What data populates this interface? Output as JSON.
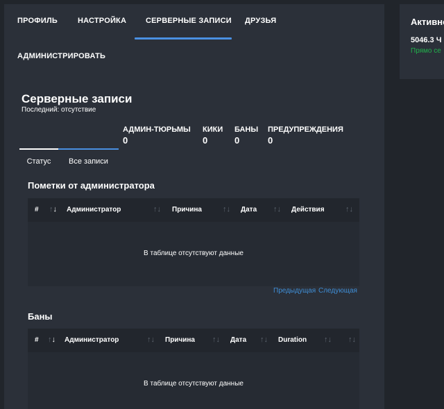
{
  "nav": {
    "tabs": [
      {
        "label": "ПРОФИЛЬ"
      },
      {
        "label": "НАСТРОЙКА"
      },
      {
        "label": "СЕРВЕРНЫЕ ЗАПИСИ"
      },
      {
        "label": "ДРУЗЬЯ"
      },
      {
        "label": "АДМИНИСТРИРОВАТЬ"
      }
    ],
    "active_tab": "СЕРВЕРНЫЕ ЗАПИСИ"
  },
  "records": {
    "title": "Серверные записи",
    "last_label": "Последний: отсутствие",
    "stats": [
      {
        "label": "АДМИН-ТЮРЬМЫ",
        "value": "0"
      },
      {
        "label": "КИКИ",
        "value": "0"
      },
      {
        "label": "БАНЫ",
        "value": "0"
      },
      {
        "label": "ПРЕДУПРЕЖДЕНИЯ",
        "value": "0"
      }
    ],
    "tabs": [
      {
        "label": "Статус"
      },
      {
        "label": "Все записи"
      }
    ]
  },
  "notes": {
    "title": "Пометки от администратора",
    "columns": [
      "#",
      "Администратор",
      "Причина",
      "Дата",
      "Действия"
    ],
    "empty_text": "В таблице отсутствуют данные",
    "prev_label": "Предыдущая",
    "next_label": "Следующая"
  },
  "bans": {
    "title": "Баны",
    "columns": [
      "#",
      "Администратор",
      "Причина",
      "Дата",
      "Duration"
    ],
    "empty_text": "В таблице отсутствуют данные"
  },
  "side": {
    "title": "Активно",
    "hours": "5046.3 Ч",
    "status": "Прямо се"
  },
  "colors": {
    "accent": "#4a90e2",
    "link": "#3f8ed6",
    "online": "#22b14c"
  }
}
